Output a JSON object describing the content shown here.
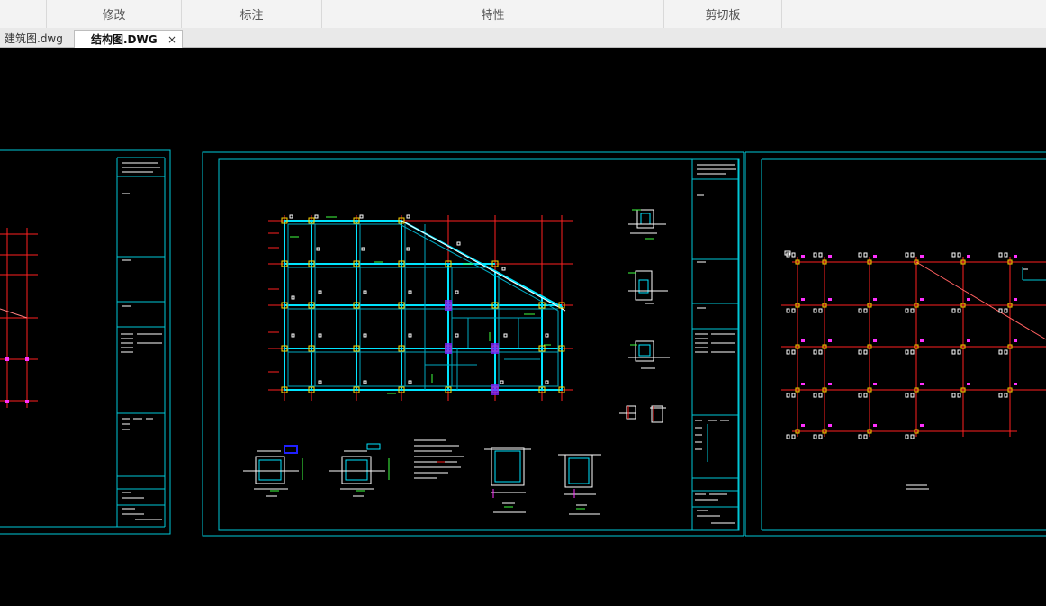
{
  "ribbon": {
    "groups": [
      "修改",
      "标注",
      "特性",
      "剪切板"
    ]
  },
  "tabs": {
    "items": [
      {
        "label": "建筑图.dwg",
        "active": false
      },
      {
        "label": "结构图.DWG",
        "active": true
      }
    ],
    "close_glyph": "×"
  },
  "colors": {
    "background": "#000000",
    "frame": "#00c8d8",
    "grid": "#ff2020",
    "beam": "#00e5ff",
    "column": "#ffd400",
    "marker": "#ff30ff",
    "text": "#ffffff",
    "green": "#40ff40",
    "blue": "#2020ff"
  }
}
